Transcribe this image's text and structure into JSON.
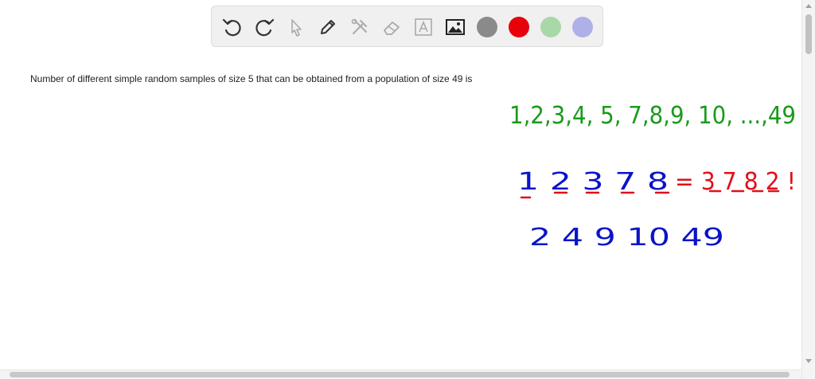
{
  "toolbar": {
    "tools": [
      {
        "name": "undo-icon"
      },
      {
        "name": "redo-icon"
      },
      {
        "name": "select-arrow-icon"
      },
      {
        "name": "pen-icon"
      },
      {
        "name": "tools-icon"
      },
      {
        "name": "eraser-icon"
      },
      {
        "name": "text-box-icon"
      },
      {
        "name": "image-icon"
      }
    ],
    "colors": [
      "#8a8a8a",
      "#e8000b",
      "#a8d8a8",
      "#b0b0e8"
    ]
  },
  "question": {
    "text": "Number of different simple random samples of size 5 that can be obtained from a population of size 49 is"
  },
  "handwriting": {
    "line1": "1,2,3,4, 5, 7,8,9, 10, ...,49",
    "line2_blue": "1  2  3  7  8",
    "line2_red": "= 3 7 8 2 !",
    "line3": "2  4  9  10 49",
    "colors": {
      "green": "#1a9a1a",
      "blue": "#0a14c8",
      "red": "#e0101a"
    }
  }
}
